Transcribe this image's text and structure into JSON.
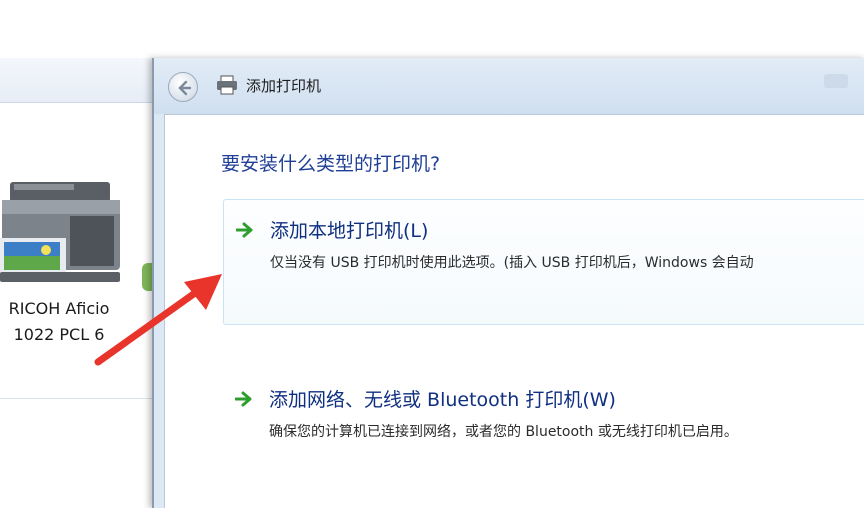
{
  "background_window": {
    "printer_name": "RICOH Aficio\n1022 PCL 6"
  },
  "dialog": {
    "title": "添加打印机",
    "heading": "要安装什么类型的打印机?",
    "options": [
      {
        "title": "添加本地打印机(L)",
        "description": "仅当没有 USB 打印机时使用此选项。(插入 USB 打印机后，Windows 会自动"
      },
      {
        "title": "添加网络、无线或 Bluetooth 打印机(W)",
        "description": "确保您的计算机已连接到网络，或者您的 Bluetooth 或无线打印机已启用。"
      }
    ]
  },
  "colors": {
    "heading": "#1f3f96",
    "option_title": "#0f2f80",
    "arrow_green": "#2e9e2e",
    "annotation_red": "#e8342a"
  },
  "icons": {
    "back": "back-arrow-icon",
    "title": "printer-icon",
    "option": "green-arrow-icon"
  }
}
